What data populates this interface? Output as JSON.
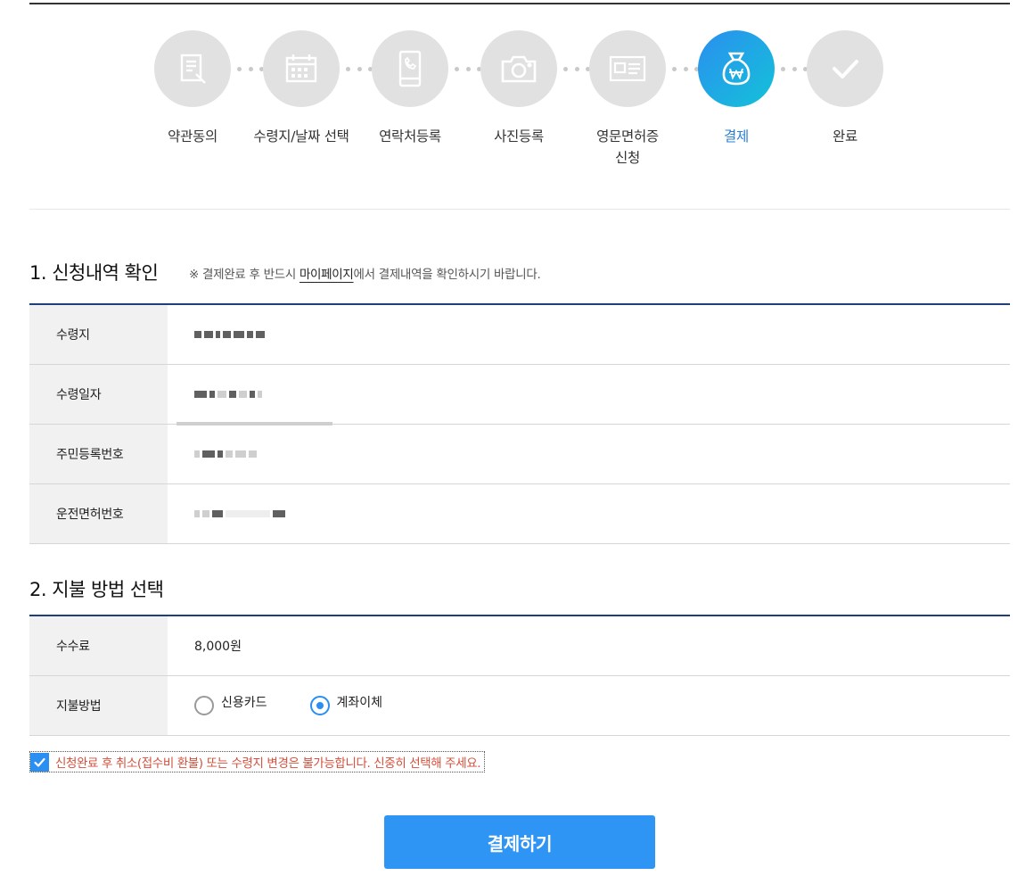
{
  "steps": [
    {
      "label": "약관동의",
      "icon": "document-pen-icon",
      "active": false
    },
    {
      "label": "수령지/날짜 선택",
      "icon": "calendar-icon",
      "active": false
    },
    {
      "label": "연락처등록",
      "icon": "phone-icon",
      "active": false
    },
    {
      "label": "사진등록",
      "icon": "camera-icon",
      "active": false
    },
    {
      "label": "영문면허증\n신청",
      "icon": "id-card-icon",
      "active": false
    },
    {
      "label": "결제",
      "icon": "money-bag-won-icon",
      "active": true
    },
    {
      "label": "완료",
      "icon": "checkmark-icon",
      "active": false
    }
  ],
  "section1": {
    "title": "1. 신청내역 확인",
    "note_prefix": "※ 결제완료 후 반드시 ",
    "note_link": "마이페이지",
    "note_suffix": "에서 결제내역을 확인하시기 바랍니다.",
    "rows": [
      {
        "label": "수령지"
      },
      {
        "label": "수령일자"
      },
      {
        "label": "주민등록번호"
      },
      {
        "label": "운전면허번호"
      }
    ]
  },
  "section2": {
    "title": "2. 지불 방법 선택",
    "fee_label": "수수료",
    "fee_value": "8,000원",
    "method_label": "지불방법",
    "options": [
      {
        "label": "신용카드",
        "selected": false
      },
      {
        "label": "계좌이체",
        "selected": true
      }
    ]
  },
  "agreement": {
    "checked": true,
    "text": "신청완료 후 취소(접수비 환불) 또는 수령지 변경은 불가능합니다. 신중히 선택해 주세요."
  },
  "pay_button": "결제하기",
  "colors": {
    "accent": "#2f95f5",
    "table_border": "#1e3f7a",
    "warning_text": "#d2503c"
  }
}
